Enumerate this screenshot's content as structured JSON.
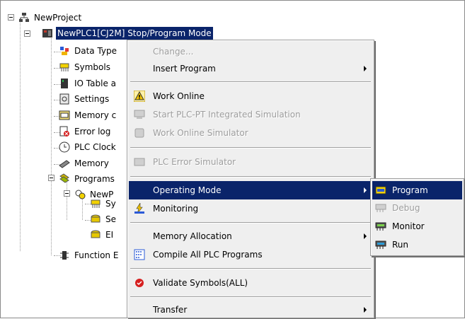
{
  "tree": {
    "project": "NewProject",
    "plc": "NewPLC1[CJ2M] Stop/Program Mode",
    "children": [
      {
        "label": "Data Type",
        "icon": "data-type-icon"
      },
      {
        "label": "Symbols",
        "icon": "symbols-icon"
      },
      {
        "label": "IO Table a",
        "icon": "io-table-icon"
      },
      {
        "label": "Settings",
        "icon": "settings-icon"
      },
      {
        "label": "Memory c",
        "icon": "memory-card-icon"
      },
      {
        "label": "Error log",
        "icon": "error-log-icon"
      },
      {
        "label": "PLC Clock",
        "icon": "plc-clock-icon"
      },
      {
        "label": "Memory",
        "icon": "memory-icon"
      },
      {
        "label": "Programs",
        "icon": "programs-icon"
      }
    ],
    "program": "NewP",
    "program_children": [
      {
        "label": "Sy",
        "icon": "symbols-icon"
      },
      {
        "label": "Se",
        "icon": "section-icon"
      },
      {
        "label": "EI",
        "icon": "end-section-icon"
      }
    ],
    "function_block": "Function E"
  },
  "context_menu": {
    "items": [
      {
        "label": "Change...",
        "disabled": true
      },
      {
        "label": "Insert Program",
        "submenu": true
      },
      {
        "label": "Work Online",
        "icon": "warning-icon"
      },
      {
        "label": "Start PLC-PT Integrated Simulation",
        "disabled": true
      },
      {
        "label": "Work Online Simulator",
        "disabled": true
      },
      {
        "label": "PLC Error Simulator",
        "disabled": true
      },
      {
        "label": "Operating Mode",
        "submenu": true,
        "highlighted": true
      },
      {
        "label": "Monitoring"
      },
      {
        "label": "Memory Allocation",
        "submenu": true
      },
      {
        "label": "Compile All PLC Programs"
      },
      {
        "label": "Validate Symbols(ALL)"
      },
      {
        "label": "Transfer",
        "submenu": true
      }
    ]
  },
  "submenu": {
    "items": [
      {
        "label": "Program",
        "highlighted": true
      },
      {
        "label": "Debug",
        "disabled": true
      },
      {
        "label": "Monitor"
      },
      {
        "label": "Run"
      }
    ]
  },
  "colors": {
    "selection": "#0a246a",
    "menu_bg": "#efefef",
    "disabled_text": "#9d9d9d"
  }
}
